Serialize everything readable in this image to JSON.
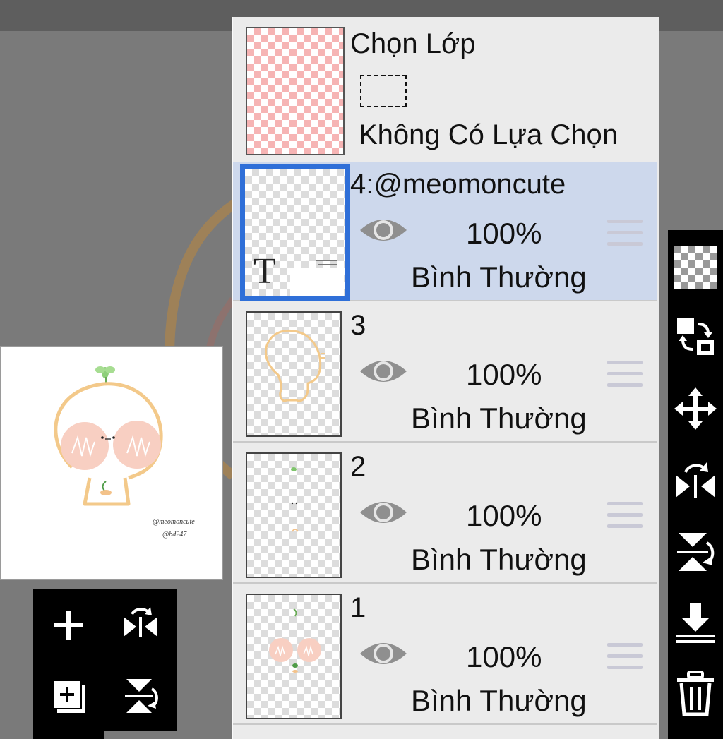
{
  "select_layer": {
    "title": "Chọn Lớp",
    "status": "Không Có Lựa Chọn"
  },
  "layers": [
    {
      "name": "4:@meomoncute",
      "opacity": "100%",
      "blend": "Bình Thường",
      "active": true
    },
    {
      "name": "3",
      "opacity": "100%",
      "blend": "Bình Thường",
      "active": false
    },
    {
      "name": "2",
      "opacity": "100%",
      "blend": "Bình Thường",
      "active": false
    },
    {
      "name": "1",
      "opacity": "100%",
      "blend": "Bình Thường",
      "active": false
    }
  ],
  "text_layer_glyph": "T",
  "preview": {
    "watermark_1": "@meomoncute",
    "watermark_2": "@bd247"
  },
  "icons": {
    "layer_tools": [
      "add-layer-icon",
      "flip-horizontal-icon",
      "add-layer-copy-icon",
      "flip-vertical-icon"
    ],
    "right_toolbar": [
      "transparency-icon",
      "swap-layers-icon",
      "move-icon",
      "flip-horizontal-icon",
      "flip-vertical-icon",
      "merge-down-icon",
      "trash-icon"
    ]
  },
  "colors": {
    "active_highlight": "#cdd8ec",
    "active_border": "#2f6fd8",
    "selection_checker": "#f6b4b4",
    "panel_bg": "#ebebeb"
  }
}
